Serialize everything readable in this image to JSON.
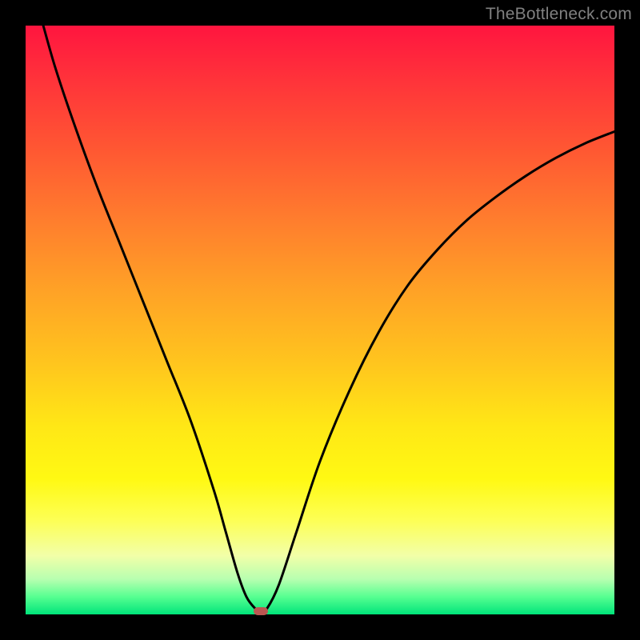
{
  "watermark": "TheBottleneck.com",
  "chart_data": {
    "type": "line",
    "title": "",
    "xlabel": "",
    "ylabel": "",
    "xlim": [
      0,
      100
    ],
    "ylim": [
      0,
      100
    ],
    "grid": false,
    "series": [
      {
        "name": "curve",
        "x": [
          3,
          5,
          8,
          12,
          16,
          20,
          24,
          28,
          32,
          34,
          36,
          37.5,
          39,
          40,
          41,
          43,
          46,
          50,
          55,
          60,
          65,
          70,
          75,
          80,
          85,
          90,
          95,
          100
        ],
        "y": [
          100,
          93,
          84,
          73,
          63,
          53,
          43,
          33,
          21,
          14,
          7,
          3,
          1,
          0.5,
          1,
          5,
          14,
          26,
          38,
          48,
          56,
          62,
          67,
          71,
          74.5,
          77.5,
          80,
          82
        ]
      }
    ],
    "marker": {
      "x": 40,
      "y": 0.5,
      "color": "#bb5651"
    },
    "background_gradient": {
      "stops": [
        {
          "pos": 0.0,
          "color": "#ff153f"
        },
        {
          "pos": 0.2,
          "color": "#ff5433"
        },
        {
          "pos": 0.45,
          "color": "#ffa226"
        },
        {
          "pos": 0.68,
          "color": "#ffe716"
        },
        {
          "pos": 0.9,
          "color": "#f2ffa8"
        },
        {
          "pos": 1.0,
          "color": "#00e47a"
        }
      ]
    }
  }
}
